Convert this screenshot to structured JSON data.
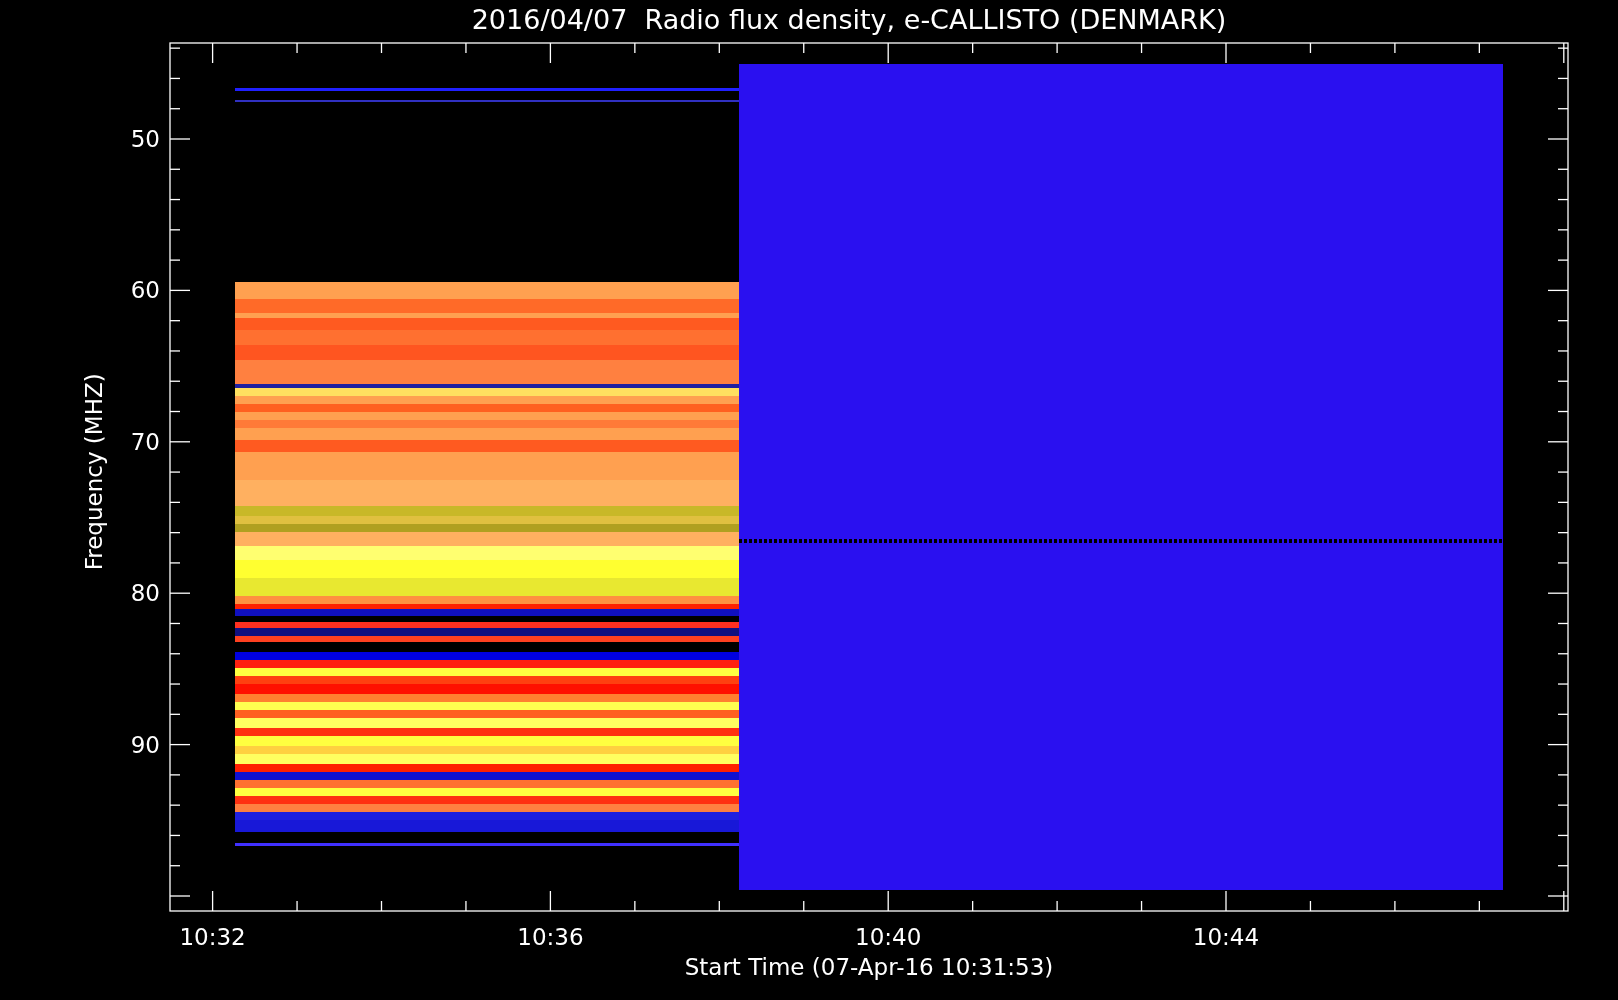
{
  "title": "2016/04/07  Radio flux density, e-CALLISTO (DENMARK)",
  "y_axis": {
    "label": "Frequency (MHZ)",
    "ticks": [
      "50",
      "60",
      "70",
      "80",
      "90"
    ]
  },
  "x_axis": {
    "label": "Start Time (07-Apr-16 10:31:53)",
    "ticks": [
      "10:32",
      "10:36",
      "10:40",
      "10:44"
    ]
  }
}
